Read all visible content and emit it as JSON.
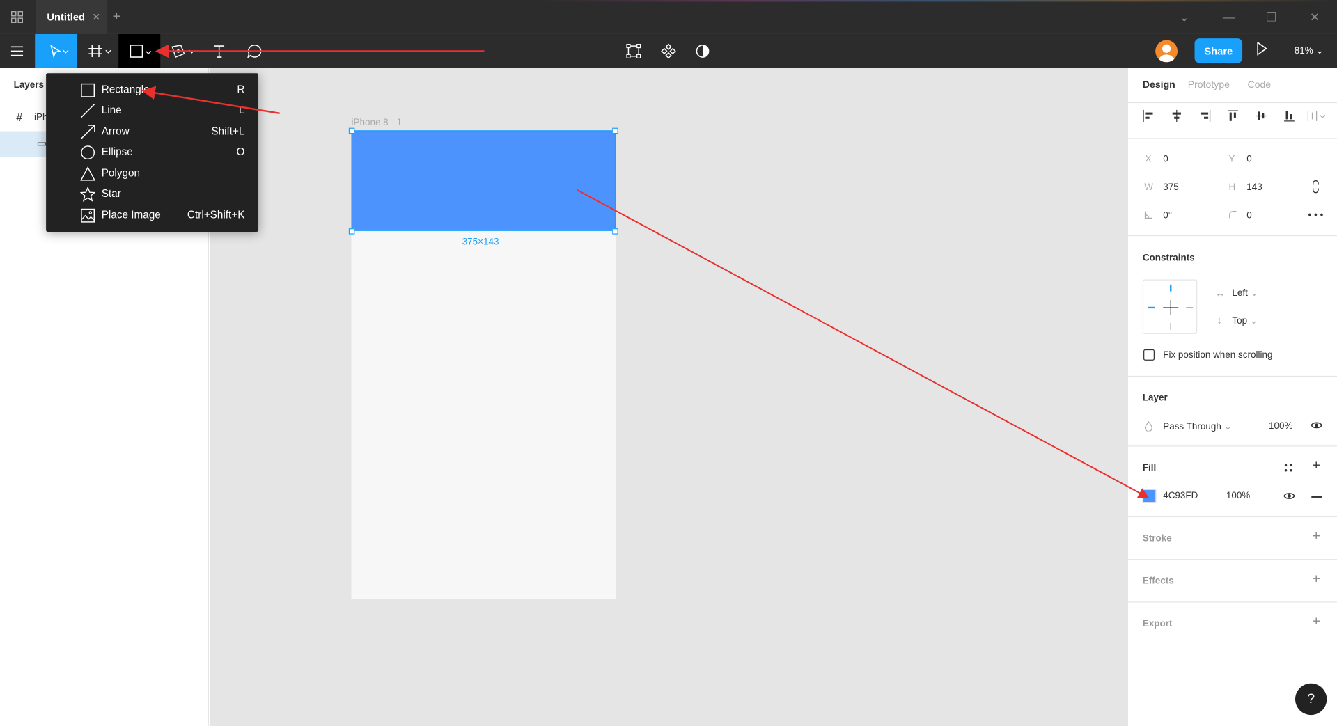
{
  "titlebar": {
    "tab_title": "Untitled",
    "tab_close": "✕",
    "tab_add": "+",
    "chevron": "⌄",
    "minimize": "—",
    "restore": "❐",
    "close": "✕"
  },
  "toolbar": {
    "share_label": "Share",
    "zoom": "81%"
  },
  "left_panel": {
    "title": "Layers",
    "frame_layer": "iPh"
  },
  "canvas": {
    "frame_name": "iPhone 8 - 1",
    "dims": "375×143"
  },
  "shape_menu": {
    "items": [
      {
        "label": "Rectangle",
        "key": "R"
      },
      {
        "label": "Line",
        "key": "L"
      },
      {
        "label": "Arrow",
        "key": "Shift+L"
      },
      {
        "label": "Ellipse",
        "key": "O"
      },
      {
        "label": "Polygon",
        "key": ""
      },
      {
        "label": "Star",
        "key": ""
      },
      {
        "label": "Place Image",
        "key": "Ctrl+Shift+K"
      }
    ]
  },
  "right_panel": {
    "tabs": [
      "Design",
      "Prototype",
      "Code"
    ],
    "x_label": "X",
    "x": "0",
    "y_label": "Y",
    "y": "0",
    "w_label": "W",
    "w": "375",
    "h_label": "H",
    "h": "143",
    "rotation": "0°",
    "radius": "0",
    "constraints_title": "Constraints",
    "constraint_h": "Left",
    "constraint_v": "Top",
    "fix_position": "Fix position when scrolling",
    "layer_title": "Layer",
    "blend_mode": "Pass Through",
    "layer_opacity": "100%",
    "fill_title": "Fill",
    "fill_hex": "4C93FD",
    "fill_opacity": "100%",
    "stroke_title": "Stroke",
    "effects_title": "Effects",
    "export_title": "Export"
  },
  "help": "?",
  "colors": {
    "accent": "#18a0fb",
    "fill": "#4c93fd",
    "annotation": "#e8302f"
  }
}
